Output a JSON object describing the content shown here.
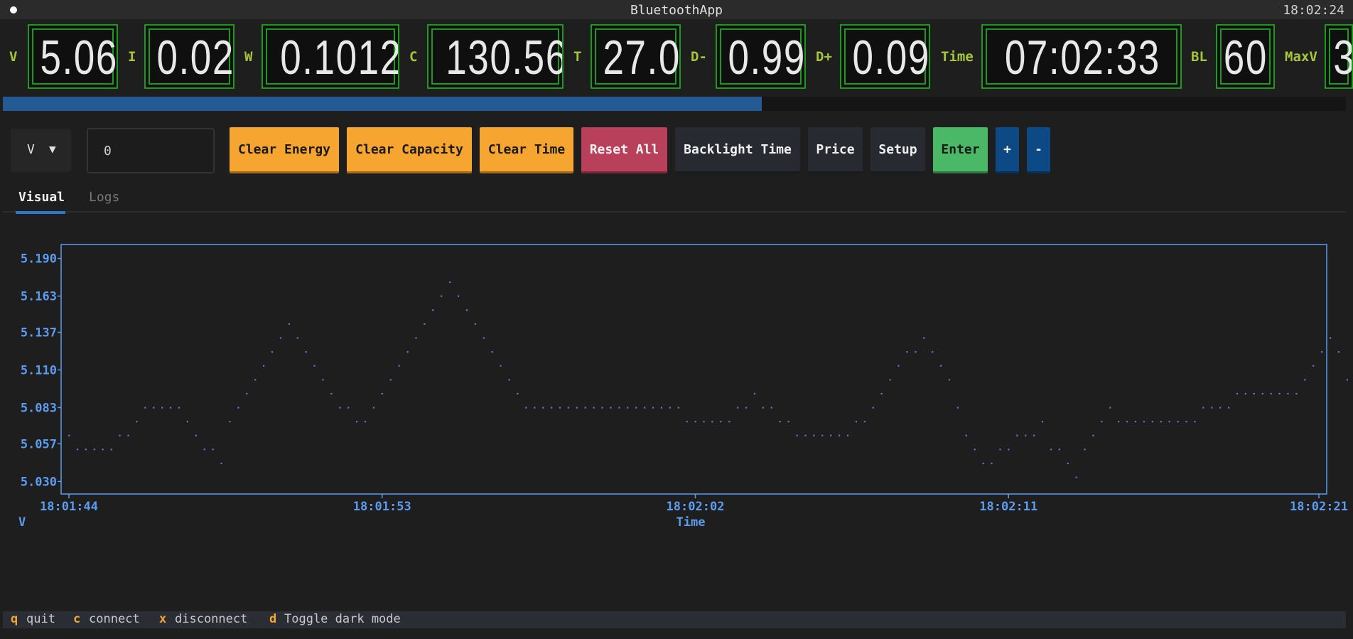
{
  "window": {
    "title": "BluetoothApp",
    "clock": "18:02:24"
  },
  "metrics": [
    {
      "label": "V",
      "value": "5.06"
    },
    {
      "label": "I",
      "value": "0.02"
    },
    {
      "label": "W",
      "value": "0.1012"
    },
    {
      "label": "C",
      "value": "130.56"
    },
    {
      "label": "T",
      "value": "27.0"
    },
    {
      "label": "D-",
      "value": "0.99"
    },
    {
      "label": "D+",
      "value": "0.09"
    },
    {
      "label": "Time",
      "value": "07:02:33"
    },
    {
      "label": "BL",
      "value": "60"
    },
    {
      "label": "MaxV",
      "value": "3"
    }
  ],
  "progress": {
    "fraction": 0.565
  },
  "controls": {
    "mode_select": {
      "value": "V",
      "caret": "▼"
    },
    "value_input": {
      "value": "0"
    },
    "buttons": {
      "clear_energy": "Clear Energy",
      "clear_capacity": "Clear Capacity",
      "clear_time": "Clear Time",
      "reset_all": "Reset All",
      "backlight_time": "Backlight Time",
      "price": "Price",
      "setup": "Setup",
      "enter": "Enter",
      "plus": "+",
      "minus": "-"
    }
  },
  "tabs": {
    "visual": "Visual",
    "logs": "Logs",
    "active": "visual"
  },
  "colors": {
    "accent": "#2b79c9",
    "chart": "#5b9cf0",
    "points": "#6a6fd8",
    "orange": "#f6a630",
    "label_green": "#a5c63a"
  },
  "chart_data": {
    "type": "scatter",
    "title": "",
    "xlabel": "Time",
    "ylabel": "V",
    "x_ticks": [
      "18:01:44",
      "18:01:53",
      "18:02:02",
      "18:02:11",
      "18:02:21"
    ],
    "y_ticks": [
      "5.190",
      "5.163",
      "5.137",
      "5.110",
      "5.083",
      "5.057",
      "5.030"
    ],
    "ylim": [
      5.021,
      5.2
    ],
    "x_range_seconds": [
      0,
      37
    ],
    "grid": false,
    "points_per_second": 4,
    "values": [
      5.063,
      5.053,
      5.053,
      5.053,
      5.053,
      5.053,
      5.063,
      5.063,
      5.073,
      5.083,
      5.083,
      5.083,
      5.083,
      5.083,
      5.073,
      5.063,
      5.053,
      5.053,
      5.043,
      5.073,
      5.083,
      5.093,
      5.103,
      5.113,
      5.123,
      5.133,
      5.143,
      5.133,
      5.123,
      5.113,
      5.103,
      5.093,
      5.083,
      5.083,
      5.073,
      5.073,
      5.083,
      5.093,
      5.103,
      5.113,
      5.123,
      5.133,
      5.143,
      5.153,
      5.163,
      5.173,
      5.163,
      5.153,
      5.143,
      5.133,
      5.123,
      5.113,
      5.103,
      5.093,
      5.083,
      5.083,
      5.083,
      5.083,
      5.083,
      5.083,
      5.083,
      5.083,
      5.083,
      5.083,
      5.083,
      5.083,
      5.083,
      5.083,
      5.083,
      5.083,
      5.083,
      5.083,
      5.083,
      5.073,
      5.073,
      5.073,
      5.073,
      5.073,
      5.073,
      5.083,
      5.083,
      5.093,
      5.083,
      5.083,
      5.073,
      5.073,
      5.063,
      5.063,
      5.063,
      5.063,
      5.063,
      5.063,
      5.063,
      5.073,
      5.073,
      5.083,
      5.093,
      5.103,
      5.113,
      5.123,
      5.123,
      5.133,
      5.123,
      5.113,
      5.103,
      5.083,
      5.063,
      5.053,
      5.043,
      5.043,
      5.053,
      5.053,
      5.063,
      5.063,
      5.063,
      5.073,
      5.053,
      5.053,
      5.043,
      5.033,
      5.053,
      5.063,
      5.073,
      5.083,
      5.073,
      5.073,
      5.073,
      5.073,
      5.073,
      5.073,
      5.073,
      5.073,
      5.073,
      5.073,
      5.083,
      5.083,
      5.083,
      5.083,
      5.093,
      5.093,
      5.093,
      5.093,
      5.093,
      5.093,
      5.093,
      5.093,
      5.103,
      5.113,
      5.123,
      5.133,
      5.123,
      5.103,
      5.093,
      5.073,
      5.053,
      5.053,
      5.043,
      5.063,
      5.073,
      5.083,
      5.093,
      5.093,
      5.103,
      5.113,
      5.113,
      5.113,
      5.123,
      5.113,
      5.103,
      5.093,
      5.093,
      5.083,
      5.083,
      5.083,
      5.083,
      5.093,
      5.103,
      5.113,
      5.123,
      5.133,
      5.143,
      5.153,
      5.163,
      5.173,
      5.163,
      5.153,
      5.143,
      5.133,
      5.113,
      5.093,
      5.083,
      5.073,
      5.073,
      5.073,
      5.073,
      5.073,
      5.083,
      5.093,
      5.113,
      5.133,
      5.153,
      5.163,
      5.173,
      5.183,
      5.173,
      5.163,
      5.153,
      5.143,
      5.133,
      5.113,
      5.093,
      5.083,
      5.073,
      5.063
    ]
  }
}
